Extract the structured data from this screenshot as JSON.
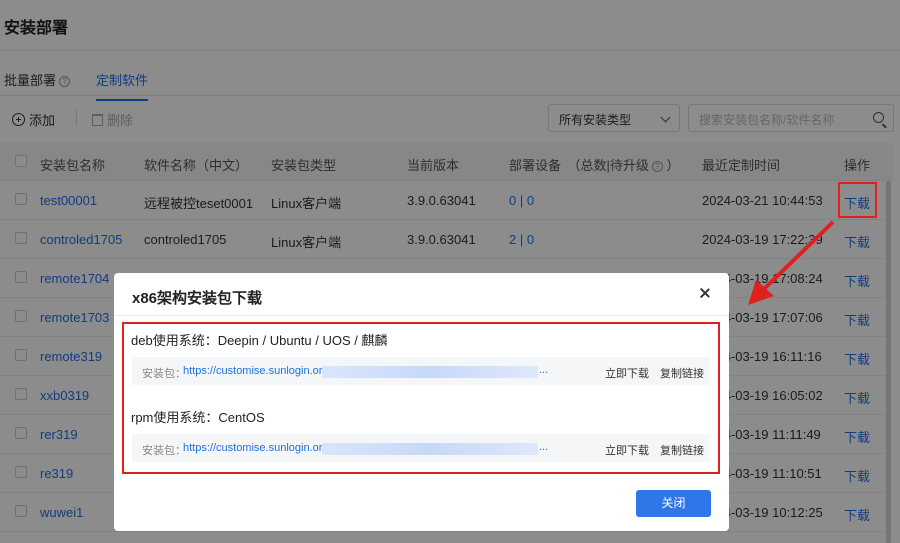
{
  "page": {
    "title": "安装部署"
  },
  "tabs": [
    {
      "label": "批量部署"
    },
    {
      "label": "定制软件"
    }
  ],
  "toolbar": {
    "add_label": "添加",
    "delete_label": "删除",
    "type_select_value": "所有安装类型",
    "search_placeholder": "搜索安装包名称/软件名称"
  },
  "table": {
    "headers": [
      "安装包名称",
      "软件名称（中文）",
      "安装包类型",
      "当前版本",
      "部署设备　（总数|待升级",
      "最近定制时间",
      "操作"
    ],
    "rows": [
      {
        "name": "test00001",
        "software": "远程被控teset0001",
        "type": "Linux客户端",
        "version": "3.9.0.63041",
        "devices": "0 | 0",
        "time": "2024-03-21 10:44:53",
        "op": "下载"
      },
      {
        "name": "controled1705",
        "software": "controled1705",
        "type": "Linux客户端",
        "version": "3.9.0.63041",
        "devices": "2 | 0",
        "time": "2024-03-19 17:22:39",
        "op": "下载"
      },
      {
        "name": "remote1704",
        "software": "",
        "type": "",
        "version": "",
        "devices": "",
        "time": "2024-03-19 17:08:24",
        "op": "下载"
      },
      {
        "name": "remote1703",
        "software": "",
        "type": "",
        "version": "",
        "devices": "",
        "time": "2024-03-19 17:07:06",
        "op": "下载"
      },
      {
        "name": "remote319",
        "software": "",
        "type": "",
        "version": "",
        "devices": "",
        "time": "2024-03-19 16:11:16",
        "op": "下载"
      },
      {
        "name": "xxb0319",
        "software": "",
        "type": "",
        "version": "",
        "devices": "",
        "time": "2024-03-19 16:05:02",
        "op": "下载"
      },
      {
        "name": "rer319",
        "software": "",
        "type": "",
        "version": "",
        "devices": "",
        "time": "2024-03-19 11:11:49",
        "op": "下载"
      },
      {
        "name": "re319",
        "software": "",
        "type": "",
        "version": "",
        "devices": "",
        "time": "2024-03-19 11:10:51",
        "op": "下载"
      },
      {
        "name": "wuwei1",
        "software": "",
        "type": "",
        "version": "",
        "devices": "",
        "time": "2024-03-19 10:12:25",
        "op": "下载"
      }
    ]
  },
  "modal": {
    "title": "x86架构安装包下载",
    "sections": [
      {
        "title": "deb使用系统：Deepin / Ubuntu / UOS / 麒麟",
        "pkg_label": "安装包：",
        "url": "https://customise.sunlogin.or",
        "ellipsis": "...",
        "download_label": "立即下载",
        "copy_label": "复制链接"
      },
      {
        "title": "rpm使用系统：CentOS",
        "pkg_label": "安装包：",
        "url": "https://customise.sunlogin.or",
        "ellipsis": "...",
        "download_label": "立即下载",
        "copy_label": "复制链接"
      }
    ],
    "close_button": "关闭"
  },
  "colors": {
    "accent": "#1e6fe6",
    "highlight": "#e0201d",
    "button": "#2f76e8"
  }
}
